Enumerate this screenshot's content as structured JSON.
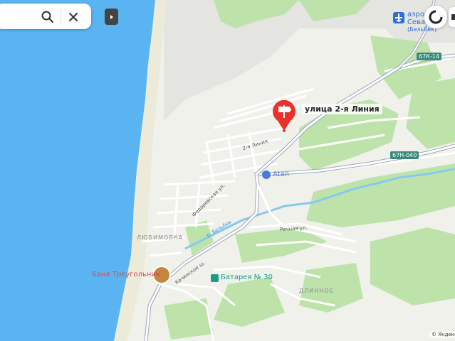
{
  "search": {
    "search_icon": "search-icon",
    "close_icon": "close-icon"
  },
  "controls": {
    "panel_toggle_icon": "triangle-right-icon",
    "location_icon": "compass-icon"
  },
  "pin": {
    "label": "улица 2-я Линия",
    "color": "#e8322b",
    "icon": "signpost-icon"
  },
  "places": {
    "airport_line1": "аэроп",
    "airport_line2": "Сева",
    "airport_line3": "(Бельбек)",
    "atan": "Atan",
    "banya": "Баня Треугольник",
    "battery": "Батарея № 30",
    "lyubimovka": "ЛЮБИМОВКА",
    "dlinnoe": "ДЛИННОЕ"
  },
  "streets": {
    "second_line": "2-я Линия",
    "fedorovskaya": "Федоровская ул.",
    "kachinskoe": "Качинское ш.",
    "rechnaya": "Речная ул.",
    "belbek_river": "р. Бельбек"
  },
  "road_numbers": {
    "r67k14": "67К-14",
    "r67n040": "67Н-040"
  },
  "copyright": "© Яндекс",
  "colors": {
    "sea": "#5ab4f2",
    "beach": "#eceadb",
    "green": "#b7e0a6",
    "road": "#ffffff",
    "major_road": "#9aa7b8",
    "river": "#7fc6ec",
    "pin": "#e8322b",
    "poi_teal": "#1c9c84"
  }
}
